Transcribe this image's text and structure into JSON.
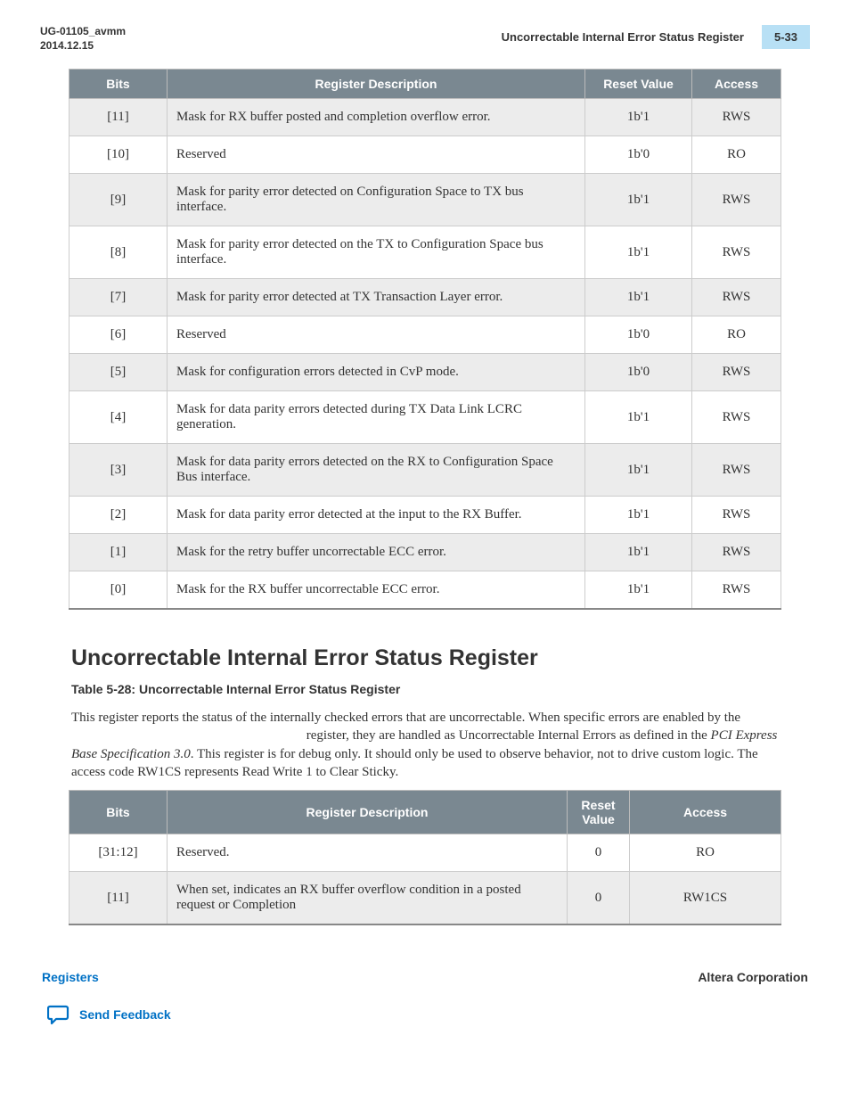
{
  "header": {
    "doc_id": "UG-01105_avmm",
    "date": "2014.12.15",
    "title": "Uncorrectable Internal Error Status Register",
    "page": "5-33"
  },
  "table1": {
    "columns": [
      "Bits",
      "Register Description",
      "Reset Value",
      "Access"
    ],
    "rows": [
      {
        "bits": "[11]",
        "desc": "Mask for RX buffer posted and completion overflow error.",
        "reset": "1b'1",
        "access": "RWS"
      },
      {
        "bits": "[10]",
        "desc": "Reserved",
        "reset": "1b'0",
        "access": "RO"
      },
      {
        "bits": "[9]",
        "desc": "Mask for parity error detected on Configuration Space to TX bus interface.",
        "reset": "1b'1",
        "access": "RWS"
      },
      {
        "bits": "[8]",
        "desc": "Mask for parity error detected on the TX to Configuration Space bus interface.",
        "reset": "1b'1",
        "access": "RWS"
      },
      {
        "bits": "[7]",
        "desc": "Mask for parity error detected at TX Transaction Layer error.",
        "reset": "1b'1",
        "access": "RWS"
      },
      {
        "bits": "[6]",
        "desc": "Reserved",
        "reset": "1b'0",
        "access": "RO"
      },
      {
        "bits": "[5]",
        "desc": "Mask for configuration errors detected in CvP mode.",
        "reset": "1b'0",
        "access": "RWS"
      },
      {
        "bits": "[4]",
        "desc": "Mask for data parity errors detected during TX Data Link LCRC generation.",
        "reset": "1b'1",
        "access": "RWS"
      },
      {
        "bits": "[3]",
        "desc": "Mask for data parity errors detected on the RX to Configuration Space Bus interface.",
        "reset": "1b'1",
        "access": "RWS"
      },
      {
        "bits": "[2]",
        "desc": "Mask for data parity error detected at the input to the RX Buffer.",
        "reset": "1b'1",
        "access": "RWS"
      },
      {
        "bits": "[1]",
        "desc": "Mask for the retry buffer uncorrectable ECC error.",
        "reset": "1b'1",
        "access": "RWS"
      },
      {
        "bits": "[0]",
        "desc": "Mask for the RX buffer uncorrectable ECC error.",
        "reset": "1b'1",
        "access": "RWS"
      }
    ]
  },
  "section": {
    "title": "Uncorrectable Internal Error Status Register",
    "table_caption": "Table 5-28: Uncorrectable Internal Error Status Register",
    "para_pre": "This register reports the status of the internally checked errors that are uncorrectable. When specific errors are enabled by the",
    "para_mid": "register, they are handled as Uncorrectable Internal Errors as defined in the ",
    "para_spec": "PCI Express Base Specification 3.0",
    "para_post": ". This register is for debug only. It should only be used to observe behavior, not to drive custom logic. The access code RW1CS represents Read Write 1 to Clear Sticky."
  },
  "table2": {
    "columns": [
      "Bits",
      "Register Description",
      "Reset Value",
      "Access"
    ],
    "rows": [
      {
        "bits": "[31:12]",
        "desc": "Reserved.",
        "reset": "0",
        "access": "RO"
      },
      {
        "bits": "[11]",
        "desc": "When set, indicates an RX buffer overflow condition in a posted request or Completion",
        "reset": "0",
        "access": "RW1CS"
      }
    ]
  },
  "footer": {
    "left": "Registers",
    "right": "Altera Corporation",
    "feedback": "Send Feedback"
  }
}
